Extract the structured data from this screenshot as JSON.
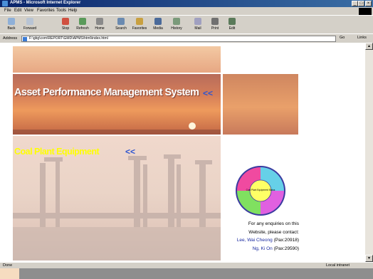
{
  "window": {
    "title": "APMS - Microsoft Internet Explorer",
    "controls": [
      "_",
      "□",
      "×"
    ]
  },
  "menu": [
    "File",
    "Edit",
    "View",
    "Favorites",
    "Tools",
    "Help"
  ],
  "toolbar": [
    {
      "label": "Back",
      "icon": "back-arrow-icon"
    },
    {
      "label": "Forward",
      "icon": "forward-arrow-icon"
    },
    {
      "label": "Stop",
      "icon": "stop-icon"
    },
    {
      "label": "Refresh",
      "icon": "refresh-icon"
    },
    {
      "label": "Home",
      "icon": "home-icon"
    },
    {
      "label": "Search",
      "icon": "search-icon"
    },
    {
      "label": "Favorites",
      "icon": "favorites-icon"
    },
    {
      "label": "Media",
      "icon": "media-icon"
    },
    {
      "label": "History",
      "icon": "history-icon"
    },
    {
      "label": "Mail",
      "icon": "mail-icon"
    },
    {
      "label": "Print",
      "icon": "print-icon"
    },
    {
      "label": "Edit",
      "icon": "edit-icon"
    }
  ],
  "address": {
    "label": "Address",
    "value": "F:\\gbg\\com\\REPORT\\GMD\\APMS\\html\\index.html",
    "go": "Go",
    "links": "Links"
  },
  "page": {
    "heading": "Asset Performance Management System",
    "heading_arrows": "<<",
    "section": "Coal Plant Equipment",
    "section_arrows": "<<",
    "enquiry_lines": [
      "For any enquiries on this",
      "Website, please contact:"
    ],
    "contacts": [
      {
        "name": "Lee, Wai Cheong",
        "pax": "(Pax:20918)"
      },
      {
        "name": "Ng, Ki On",
        "pax": "(Pax:29590)"
      }
    ],
    "wheel_center": "Coal Plant Equipment Status"
  },
  "status": {
    "left": "Done",
    "right": "Local intranet"
  },
  "colors": {
    "titlebar": "#0a246a",
    "section_text": "#ffff00",
    "arrows": "#2e55d0",
    "contact_name": "#1a2aa0"
  }
}
